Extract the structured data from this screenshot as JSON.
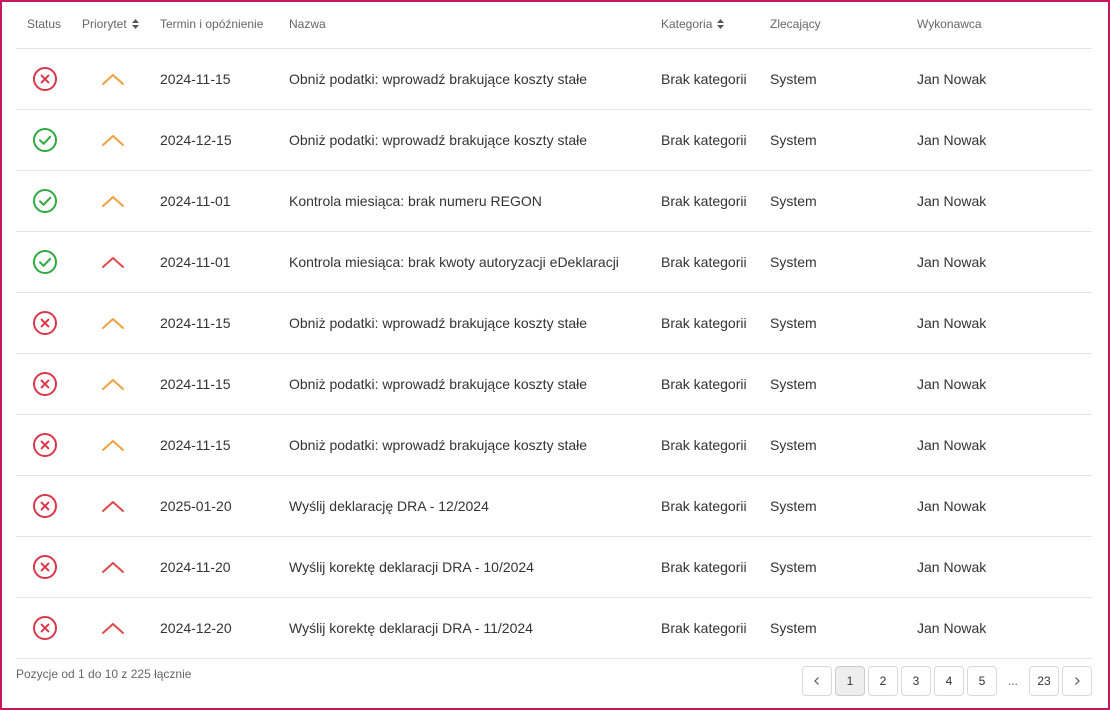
{
  "colors": {
    "frame_border": "#c8185c",
    "status_success": "#2faa3f",
    "status_error": "#d93849",
    "priority_medium": "#f0a040",
    "priority_high": "#e04a4a"
  },
  "table": {
    "headers": {
      "status": "Status",
      "priority": "Priorytet",
      "deadline": "Termin i opóźnienie",
      "name": "Nazwa",
      "category": "Kategoria",
      "orderer": "Zlecający",
      "executor": "Wykonawca"
    },
    "rows": [
      {
        "status": "error",
        "priority": "medium",
        "date": "2024-11-15",
        "name": "Obniż podatki: wprowadź brakujące koszty stałe",
        "category": "Brak kategorii",
        "orderer": "System",
        "executor": "Jan Nowak"
      },
      {
        "status": "success",
        "priority": "medium",
        "date": "2024-12-15",
        "name": "Obniż podatki: wprowadź brakujące koszty stałe",
        "category": "Brak kategorii",
        "orderer": "System",
        "executor": "Jan Nowak"
      },
      {
        "status": "success",
        "priority": "medium",
        "date": "2024-11-01",
        "name": "Kontrola miesiąca: brak numeru REGON",
        "category": "Brak kategorii",
        "orderer": "System",
        "executor": "Jan Nowak"
      },
      {
        "status": "success",
        "priority": "high",
        "date": "2024-11-01",
        "name": "Kontrola miesiąca: brak kwoty autoryzacji eDeklaracji",
        "category": "Brak kategorii",
        "orderer": "System",
        "executor": "Jan Nowak"
      },
      {
        "status": "error",
        "priority": "medium",
        "date": "2024-11-15",
        "name": "Obniż podatki: wprowadź brakujące koszty stałe",
        "category": "Brak kategorii",
        "orderer": "System",
        "executor": "Jan Nowak"
      },
      {
        "status": "error",
        "priority": "medium",
        "date": "2024-11-15",
        "name": "Obniż podatki: wprowadź brakujące koszty stałe",
        "category": "Brak kategorii",
        "orderer": "System",
        "executor": "Jan Nowak"
      },
      {
        "status": "error",
        "priority": "medium",
        "date": "2024-11-15",
        "name": "Obniż podatki: wprowadź brakujące koszty stałe",
        "category": "Brak kategorii",
        "orderer": "System",
        "executor": "Jan Nowak"
      },
      {
        "status": "error",
        "priority": "high",
        "date": "2025-01-20",
        "name": "Wyślij deklarację DRA - 12/2024",
        "category": "Brak kategorii",
        "orderer": "System",
        "executor": "Jan Nowak"
      },
      {
        "status": "error",
        "priority": "high",
        "date": "2024-11-20",
        "name": "Wyślij korektę deklaracji DRA - 10/2024",
        "category": "Brak kategorii",
        "orderer": "System",
        "executor": "Jan Nowak"
      },
      {
        "status": "error",
        "priority": "high",
        "date": "2024-12-20",
        "name": "Wyślij korektę deklaracji DRA - 11/2024",
        "category": "Brak kategorii",
        "orderer": "System",
        "executor": "Jan Nowak"
      }
    ]
  },
  "footer": {
    "summary": "Pozycje od 1 do 10 z 225 łącznie"
  },
  "pagination": {
    "prev_icon": "chevron-left-icon",
    "next_icon": "chevron-right-icon",
    "pages": [
      "1",
      "2",
      "3",
      "4",
      "5"
    ],
    "ellipsis": "...",
    "last_page": "23",
    "current_page": "1"
  }
}
